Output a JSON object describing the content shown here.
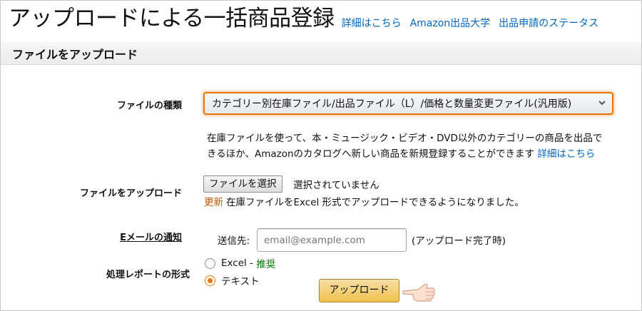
{
  "header": {
    "title": "アップロードによる一括商品登録",
    "links": [
      "詳細はこちら",
      "Amazon出品大学",
      "出品申請のステータス"
    ]
  },
  "section": {
    "title": "ファイルをアップロード"
  },
  "file_type": {
    "label": "ファイルの種類",
    "selected": "カテゴリー別在庫ファイル/出品ファイル（L）/価格と数量変更ファイル(汎用版)",
    "description_line1": "在庫ファイルを使って、本・ミュージック・ビデオ・DVD以外のカテゴリーの商品を出品で",
    "description_line2": "きるほか、Amazonのカタログへ新しい商品を新規登録することができます",
    "description_link": "詳細はこちら"
  },
  "upload_file": {
    "label": "ファイルをアップロード",
    "button": "ファイルを選択",
    "status": "選択されていません",
    "update_badge": "更新",
    "update_note": "在庫ファイルをExcel 形式でアップロードできるようになりました。"
  },
  "email_notify": {
    "label": "Eメールの通知",
    "prefix": "送信先:",
    "placeholder": "email@example.com",
    "value": "",
    "suffix": "(アップロード完了時)"
  },
  "report_format": {
    "label": "処理レポートの形式",
    "options": [
      {
        "label": "Excel",
        "note": "推奨",
        "selected": false
      },
      {
        "label": "テキスト",
        "selected": true
      }
    ]
  },
  "upload_button": "アップロード",
  "colors": {
    "link": "#0066c0",
    "accent": "#e77600",
    "button": "#f0c14b",
    "recommend": "#007600",
    "update": "#c45500"
  },
  "icons": [
    "chevron-down-icon",
    "pointing-hand-icon"
  ]
}
